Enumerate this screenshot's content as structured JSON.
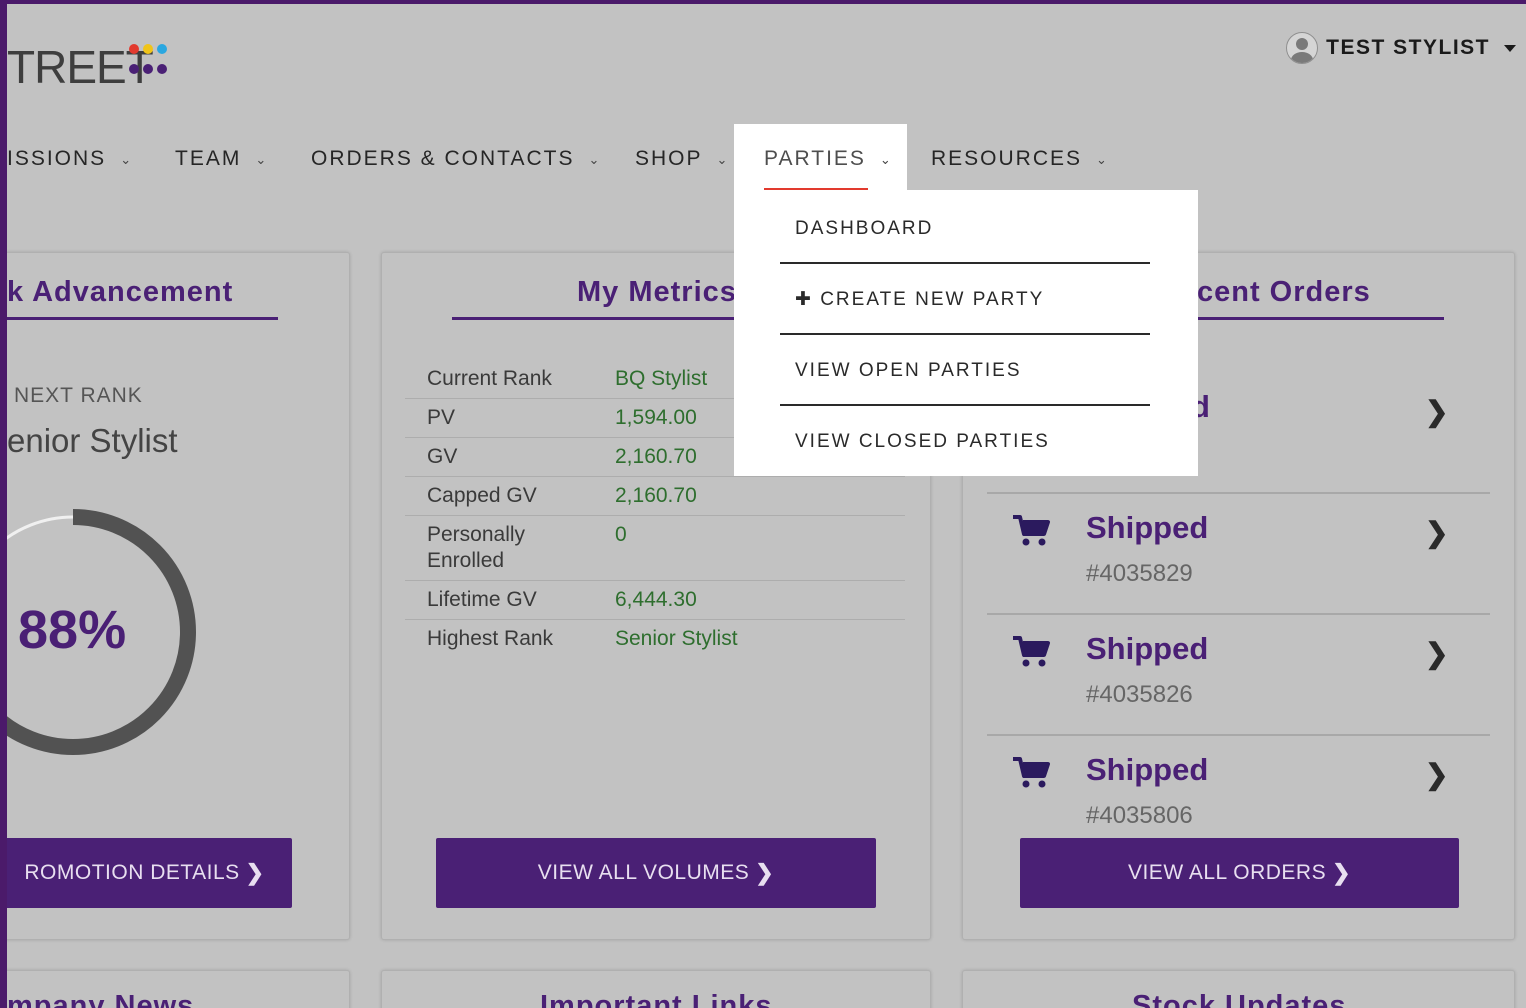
{
  "header": {
    "logo_text": "TREET",
    "logo_dot_colors": [
      "#e23a2e",
      "#f0c419",
      "#2aa7e0",
      "#4a2075",
      "#4a2075",
      "#4a2075"
    ],
    "user_name": "TEST STYLIST"
  },
  "nav": {
    "items": [
      {
        "label": "ISSIONS"
      },
      {
        "label": "TEAM"
      },
      {
        "label": "ORDERS & CONTACTS"
      },
      {
        "label": "SHOP"
      },
      {
        "label": "PARTIES"
      },
      {
        "label": "RESOURCES"
      }
    ],
    "active_index": 4,
    "chevron": "⌄"
  },
  "dropdown": {
    "items": [
      {
        "label": "DASHBOARD"
      },
      {
        "label": "✚ CREATE NEW PARTY"
      },
      {
        "label": "VIEW OPEN PARTIES"
      },
      {
        "label": "VIEW CLOSED PARTIES"
      }
    ]
  },
  "rank_panel": {
    "title": "k Advancement",
    "next_rank_label": "NEXT RANK",
    "next_rank_value": "enior Stylist",
    "progress_percent_text": "88%",
    "progress_value": 0.88,
    "button_label": "ROMOTION DETAILS"
  },
  "metrics_panel": {
    "title": "My Metrics",
    "rows": [
      {
        "label": "Current Rank",
        "value": "BQ Stylist"
      },
      {
        "label": "PV",
        "value": "1,594.00"
      },
      {
        "label": "GV",
        "value": "2,160.70"
      },
      {
        "label": "Capped GV",
        "value": "2,160.70"
      },
      {
        "label": "Personally Enrolled",
        "value": "0"
      },
      {
        "label": "Lifetime GV",
        "value": "6,444.30"
      },
      {
        "label": "Highest Rank",
        "value": "Senior Stylist"
      }
    ],
    "button_label": "VIEW ALL VOLUMES"
  },
  "orders_panel": {
    "title": "cent Orders",
    "partial_status": "d",
    "orders": [
      {
        "status": "Shipped",
        "number": "#4035829"
      },
      {
        "status": "Shipped",
        "number": "#4035826"
      },
      {
        "status": "Shipped",
        "number": "#4035806"
      }
    ],
    "button_label": "VIEW ALL ORDERS"
  },
  "bottom": {
    "left_title": "mpany News",
    "middle_title": "Important Links",
    "right_title": "Stock Updates"
  },
  "colors": {
    "brand_purple": "#4a2075",
    "accent_red": "#e23a2e",
    "metric_green": "#2e6e2e"
  }
}
